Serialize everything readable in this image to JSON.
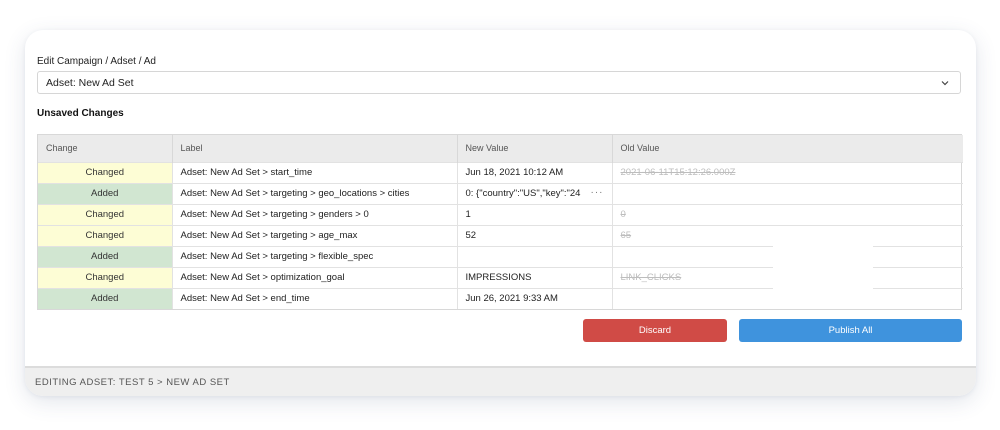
{
  "editor": {
    "section_label": "Edit Campaign / Adset / Ad",
    "select_value": "Adset: New Ad Set",
    "chevron_icon": "chevron-down-icon"
  },
  "unsaved": {
    "title": "Unsaved Changes",
    "columns": [
      "Change",
      "Label",
      "New Value",
      "Old Value"
    ],
    "rows": [
      {
        "change": "Changed",
        "label": "Adset: New Ad Set > start_time",
        "new_value": "Jun 18, 2021 10:12 AM",
        "old_value": "2021-06-11T15:12:26.000Z"
      },
      {
        "change": "Added",
        "label": "Adset: New Ad Set > targeting > geo_locations > cities",
        "new_value": "0: {\"country\":\"US\",\"key\":\"24",
        "old_value": ""
      },
      {
        "change": "Changed",
        "label": "Adset: New Ad Set > targeting > genders > 0",
        "new_value": "1",
        "old_value": "0"
      },
      {
        "change": "Changed",
        "label": "Adset: New Ad Set > targeting > age_max",
        "new_value": "52",
        "old_value": "65"
      },
      {
        "change": "Added",
        "label": "Adset: New Ad Set > targeting > flexible_spec",
        "new_value": "",
        "old_value": ""
      },
      {
        "change": "Changed",
        "label": "Adset: New Ad Set > optimization_goal",
        "new_value": "IMPRESSIONS",
        "old_value": "LINK_CLICKS"
      },
      {
        "change": "Added",
        "label": "Adset: New Ad Set > end_time",
        "new_value": "Jun 26, 2021 9:33 AM",
        "old_value": ""
      }
    ],
    "more_icon_text": "···"
  },
  "actions": {
    "discard_label": "Discard",
    "publish_label": "Publish All"
  },
  "footer": {
    "breadcrumb": "EDITING ADSET: TEST 5 > NEW AD SET"
  },
  "colors": {
    "changed_bg": "#fdfdd5",
    "added_bg": "#d1e6d1",
    "discard": "#d04b46",
    "publish": "#3f93dd"
  }
}
